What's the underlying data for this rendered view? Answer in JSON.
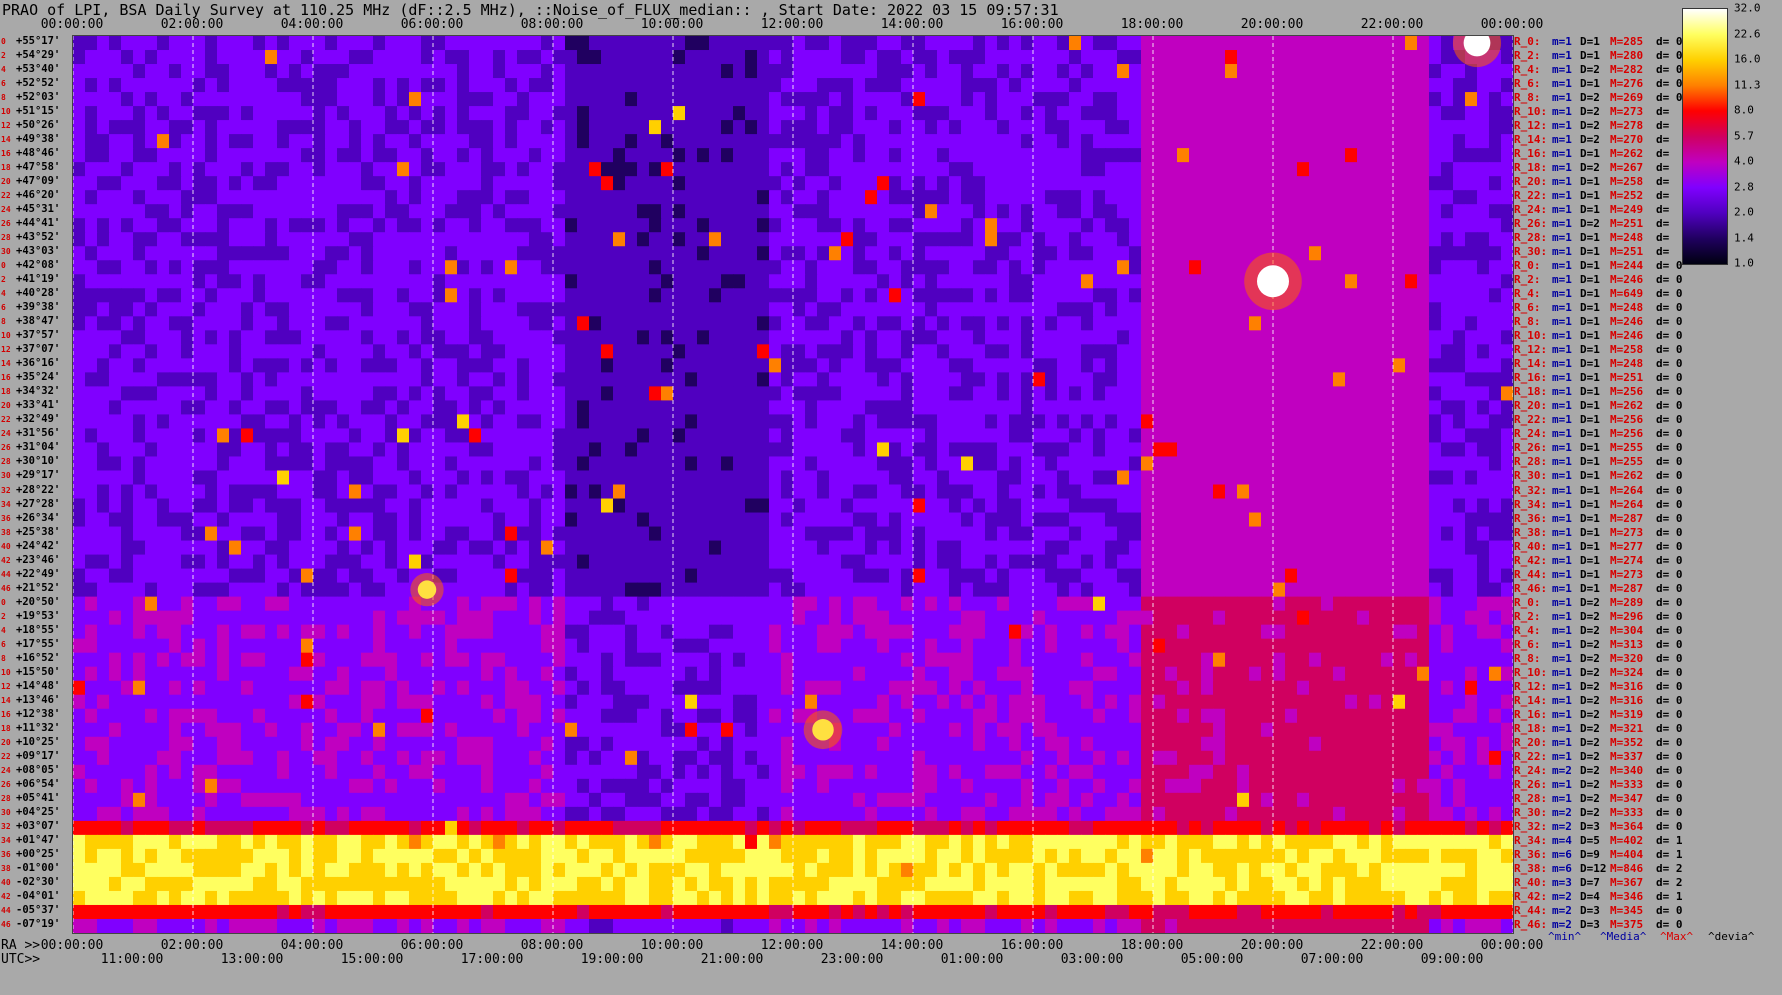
{
  "chart_data": [
    {
      "type": "heatmap",
      "title": "PRAO of LPI, BSA Daily Survey at 110.25 MHz (dF::2.5 MHz), ::Noise_of_FLUX_median:: , Start Date: 2022 03 15 09:57:31",
      "x_top_labels": [
        "00:00:00",
        "02:00:00",
        "04:00:00",
        "06:00:00",
        "08:00:00",
        "10:00:00",
        "12:00:00",
        "14:00:00",
        "16:00:00",
        "18:00:00",
        "20:00:00",
        "22:00:00",
        "00:00:00"
      ],
      "x_ra_prefix": "RA >>",
      "x_ra_labels": [
        "00:00:00",
        "02:00:00",
        "04:00:00",
        "06:00:00",
        "08:00:00",
        "10:00:00",
        "12:00:00",
        "14:00:00",
        "16:00:00",
        "18:00:00",
        "20:00:00",
        "22:00:00",
        "00:00:00"
      ],
      "x_utc_prefix": "UTC>>",
      "x_utc_labels": [
        "11:00:00",
        "13:00:00",
        "15:00:00",
        "17:00:00",
        "19:00:00",
        "21:00:00",
        "23:00:00",
        "01:00:00",
        "03:00:00",
        "05:00:00",
        "07:00:00",
        "09:00:00"
      ],
      "xlim_ra_hours": [
        0,
        24
      ],
      "y_labels": [
        "+55°17'",
        "+54°29'",
        "+53°40'",
        "+52°52'",
        "+52°03'",
        "+51°15'",
        "+50°26'",
        "+49°38'",
        "+48°46'",
        "+47°58'",
        "+47°09'",
        "+46°20'",
        "+45°31'",
        "+44°41'",
        "+43°52'",
        "+43°03'",
        "+42°08'",
        "+41°19'",
        "+40°28'",
        "+39°38'",
        "+38°47'",
        "+37°57'",
        "+37°07'",
        "+36°16'",
        "+35°24'",
        "+34°32'",
        "+33°41'",
        "+32°49'",
        "+31°56'",
        "+31°04'",
        "+30°10'",
        "+29°17'",
        "+28°22'",
        "+27°28'",
        "+26°34'",
        "+25°38'",
        "+24°42'",
        "+23°46'",
        "+22°49'",
        "+21°52'",
        "+20°50'",
        "+19°53'",
        "+18°55'",
        "+17°55'",
        "+16°52'",
        "+15°50'",
        "+14°48'",
        "+13°46'",
        "+12°38'",
        "+11°32'",
        "+10°25'",
        "+09°17'",
        "+08°05'",
        "+06°54'",
        "+05°41'",
        "+04°25'",
        "+03°07'",
        "+01°47'",
        "+00°25'",
        "-01°00'",
        "-02°30'",
        "-04°01'",
        "-05°37'",
        "-07°19'"
      ],
      "y_index": [
        "0",
        "2",
        "4",
        "6",
        "8",
        "10",
        "12",
        "14",
        "16",
        "18",
        "20",
        "22",
        "24",
        "26",
        "28",
        "30",
        "0",
        "2",
        "4",
        "6",
        "8",
        "10",
        "12",
        "14",
        "16",
        "18",
        "20",
        "22",
        "24",
        "26",
        "28",
        "30",
        "32",
        "34",
        "36",
        "38",
        "40",
        "42",
        "44",
        "46",
        "0",
        "2",
        "4",
        "6",
        "8",
        "10",
        "12",
        "14",
        "16",
        "18",
        "20",
        "22",
        "24",
        "26",
        "28",
        "30",
        "32",
        "34",
        "36",
        "38",
        "40",
        "42",
        "44",
        "46"
      ],
      "colorbar": {
        "ticks": [
          32.0,
          22.6,
          16.0,
          11.3,
          8.0,
          5.7,
          4.0,
          2.8,
          2.0,
          1.4,
          1.0
        ],
        "scale": "log",
        "colors": [
          "#ffffff",
          "#ffff60",
          "#ffd000",
          "#ff8000",
          "#ff0000",
          "#d00060",
          "#c000c0",
          "#8000ff",
          "#5000c0",
          "#200060",
          "#000010"
        ]
      },
      "features": [
        {
          "ra_hours": 20.0,
          "dec": "+41°",
          "level": 32,
          "label": ""
        },
        {
          "ra_hours": 23.4,
          "dec": "+58°",
          "level": 25,
          "label": ""
        },
        {
          "ra_hours": 12.5,
          "dec": "+12°",
          "level": 18,
          "label": ""
        },
        {
          "ra_hours": 5.9,
          "dec": "+22°",
          "level": 14,
          "label": ""
        }
      ],
      "band_rows": [
        57,
        58,
        59,
        60,
        61
      ],
      "grid": true
    }
  ],
  "right_stats": [
    [
      "R_0:",
      "m=1",
      "D=1",
      "M=285",
      "d= 0"
    ],
    [
      "R_2:",
      "m=1",
      "D=1",
      "M=280",
      "d= 0"
    ],
    [
      "R_4:",
      "m=1",
      "D=2",
      "M=282",
      "d= 0"
    ],
    [
      "R_6:",
      "m=1",
      "D=1",
      "M=276",
      "d= 0"
    ],
    [
      "R_8:",
      "m=1",
      "D=2",
      "M=269",
      "d= 0"
    ],
    [
      "R_10:",
      "m=1",
      "D=2",
      "M=273",
      "d="
    ],
    [
      "R_12:",
      "m=1",
      "D=2",
      "M=278",
      "d="
    ],
    [
      "R_14:",
      "m=1",
      "D=2",
      "M=270",
      "d="
    ],
    [
      "R_16:",
      "m=1",
      "D=1",
      "M=262",
      "d="
    ],
    [
      "R_18:",
      "m=1",
      "D=2",
      "M=267",
      "d="
    ],
    [
      "R_20:",
      "m=1",
      "D=1",
      "M=258",
      "d="
    ],
    [
      "R_22:",
      "m=1",
      "D=1",
      "M=252",
      "d="
    ],
    [
      "R_24:",
      "m=1",
      "D=1",
      "M=249",
      "d="
    ],
    [
      "R_26:",
      "m=1",
      "D=2",
      "M=251",
      "d="
    ],
    [
      "R_28:",
      "m=1",
      "D=1",
      "M=248",
      "d="
    ],
    [
      "R_30:",
      "m=1",
      "D=1",
      "M=251",
      "d="
    ],
    [
      "R_0:",
      "m=1",
      "D=1",
      "M=244",
      "d= 0"
    ],
    [
      "R_2:",
      "m=1",
      "D=1",
      "M=246",
      "d= 0"
    ],
    [
      "R_4:",
      "m=1",
      "D=1",
      "M=649",
      "d= 0"
    ],
    [
      "R_6:",
      "m=1",
      "D=1",
      "M=248",
      "d= 0"
    ],
    [
      "R_8:",
      "m=1",
      "D=1",
      "M=246",
      "d= 0"
    ],
    [
      "R_10:",
      "m=1",
      "D=1",
      "M=246",
      "d= 0"
    ],
    [
      "R_12:",
      "m=1",
      "D=1",
      "M=258",
      "d= 0"
    ],
    [
      "R_14:",
      "m=1",
      "D=1",
      "M=248",
      "d= 0"
    ],
    [
      "R_16:",
      "m=1",
      "D=1",
      "M=251",
      "d= 0"
    ],
    [
      "R_18:",
      "m=1",
      "D=1",
      "M=256",
      "d= 0"
    ],
    [
      "R_20:",
      "m=1",
      "D=1",
      "M=262",
      "d= 0"
    ],
    [
      "R_22:",
      "m=1",
      "D=1",
      "M=256",
      "d= 0"
    ],
    [
      "R_24:",
      "m=1",
      "D=1",
      "M=256",
      "d= 0"
    ],
    [
      "R_26:",
      "m=1",
      "D=1",
      "M=255",
      "d= 0"
    ],
    [
      "R_28:",
      "m=1",
      "D=1",
      "M=255",
      "d= 0"
    ],
    [
      "R_30:",
      "m=1",
      "D=1",
      "M=262",
      "d= 0"
    ],
    [
      "R_32:",
      "m=1",
      "D=1",
      "M=264",
      "d= 0"
    ],
    [
      "R_34:",
      "m=1",
      "D=1",
      "M=264",
      "d= 0"
    ],
    [
      "R_36:",
      "m=1",
      "D=1",
      "M=287",
      "d= 0"
    ],
    [
      "R_38:",
      "m=1",
      "D=1",
      "M=273",
      "d= 0"
    ],
    [
      "R_40:",
      "m=1",
      "D=1",
      "M=277",
      "d= 0"
    ],
    [
      "R_42:",
      "m=1",
      "D=1",
      "M=274",
      "d= 0"
    ],
    [
      "R_44:",
      "m=1",
      "D=1",
      "M=273",
      "d= 0"
    ],
    [
      "R_46:",
      "m=1",
      "D=1",
      "M=287",
      "d= 0"
    ],
    [
      "R_0:",
      "m=1",
      "D=2",
      "M=289",
      "d= 0"
    ],
    [
      "R_2:",
      "m=1",
      "D=2",
      "M=296",
      "d= 0"
    ],
    [
      "R_4:",
      "m=1",
      "D=2",
      "M=304",
      "d= 0"
    ],
    [
      "R_6:",
      "m=1",
      "D=2",
      "M=313",
      "d= 0"
    ],
    [
      "R_8:",
      "m=1",
      "D=2",
      "M=320",
      "d= 0"
    ],
    [
      "R_10:",
      "m=1",
      "D=2",
      "M=324",
      "d= 0"
    ],
    [
      "R_12:",
      "m=1",
      "D=2",
      "M=316",
      "d= 0"
    ],
    [
      "R_14:",
      "m=1",
      "D=2",
      "M=316",
      "d= 0"
    ],
    [
      "R_16:",
      "m=1",
      "D=2",
      "M=319",
      "d= 0"
    ],
    [
      "R_18:",
      "m=1",
      "D=2",
      "M=321",
      "d= 0"
    ],
    [
      "R_20:",
      "m=1",
      "D=2",
      "M=352",
      "d= 0"
    ],
    [
      "R_22:",
      "m=1",
      "D=2",
      "M=337",
      "d= 0"
    ],
    [
      "R_24:",
      "m=2",
      "D=2",
      "M=340",
      "d= 0"
    ],
    [
      "R_26:",
      "m=1",
      "D=2",
      "M=333",
      "d= 0"
    ],
    [
      "R_28:",
      "m=1",
      "D=2",
      "M=347",
      "d= 0"
    ],
    [
      "R_30:",
      "m=2",
      "D=2",
      "M=333",
      "d= 0"
    ],
    [
      "R_32:",
      "m=2",
      "D=3",
      "M=364",
      "d= 0"
    ],
    [
      "R_34:",
      "m=4",
      "D=5",
      "M=402",
      "d= 1"
    ],
    [
      "R_36:",
      "m=6",
      "D=9",
      "M=404",
      "d= 1"
    ],
    [
      "R_38:",
      "m=6",
      "D=12",
      "M=846",
      "d= 2"
    ],
    [
      "R_40:",
      "m=3",
      "D=7",
      "M=367",
      "d= 2"
    ],
    [
      "R_42:",
      "m=2",
      "D=4",
      "M=346",
      "d= 1"
    ],
    [
      "R_44:",
      "m=2",
      "D=3",
      "M=345",
      "d= 0"
    ],
    [
      "R_46:",
      "m=2",
      "D=3",
      "M=375",
      "d= 0"
    ]
  ],
  "legend": {
    "min": "^min^",
    "median": "^Media^",
    "max": "^Max^",
    "deviation": "^devia^"
  }
}
